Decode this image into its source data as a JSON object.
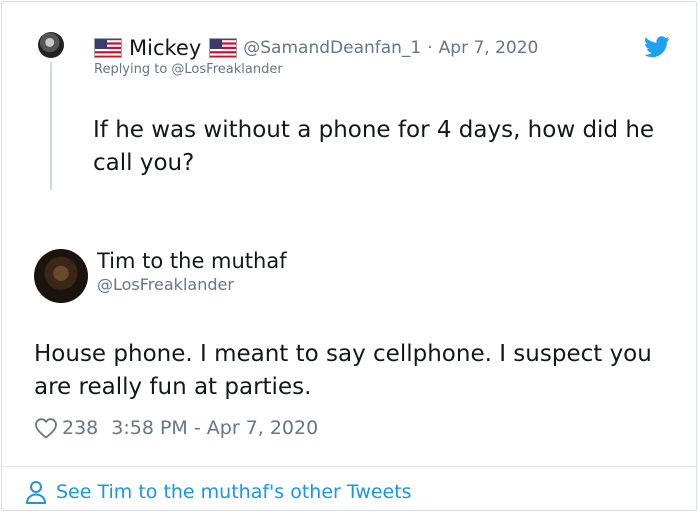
{
  "reply_tweet": {
    "display_name": "Mickey",
    "handle": "@SamandDeanfan_1",
    "separator": "·",
    "date": "Apr 7, 2020",
    "replying_to": "Replying to @LosFreaklander",
    "text": "If he was without a phone for 4 days, how did he call you?",
    "name_emoji_icon": "us-flag-icon"
  },
  "main_tweet": {
    "display_name": "Tim to the muthaf",
    "handle": "@LosFreaklander",
    "text": "House phone.  I meant to say cellphone. I suspect you are really fun at parties.",
    "likes": "238",
    "timestamp": "3:58 PM - Apr 7, 2020"
  },
  "footer": {
    "link_text": "See Tim to the muthaf's other Tweets",
    "icon": "person-icon"
  },
  "colors": {
    "text": "#14171a",
    "secondary": "#657786",
    "accent": "#1b95e0",
    "border": "#d6dde3"
  }
}
